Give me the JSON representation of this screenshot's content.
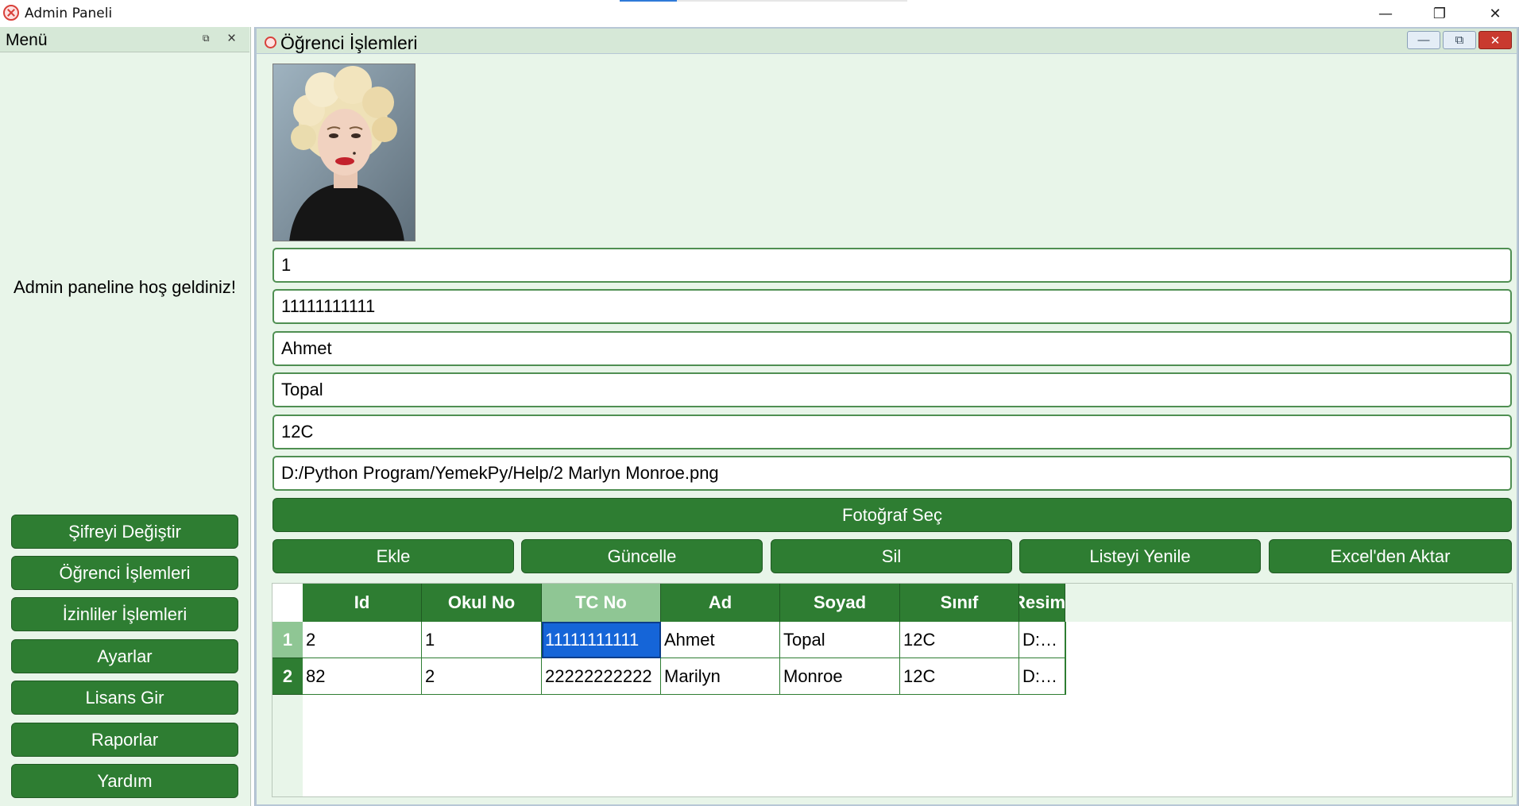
{
  "window": {
    "title": "Admin Paneli",
    "minimize_glyph": "—",
    "maximize_glyph": "❐",
    "close_glyph": "✕"
  },
  "dock": {
    "title": "Menü",
    "float_glyph": "⧉",
    "close_glyph": "×",
    "welcome": "Admin paneline hoş geldiniz!",
    "buttons": [
      "Şifreyi Değiştir",
      "Öğrenci İşlemleri",
      "İzinliler İşlemleri",
      "Ayarlar",
      "Lisans Gir",
      "Raporlar",
      "Yardım"
    ]
  },
  "subwindow": {
    "title": "Öğrenci İşlemleri",
    "minimize_glyph": "—",
    "restore_glyph": "⧉",
    "close_glyph": "✕",
    "fields": {
      "id": "1",
      "tc_no": "11111111111",
      "ad": "Ahmet",
      "soyad": "Topal",
      "sinif": "12C",
      "resim_path": "D:/Python Program/YemekPy/Help/2 Marlyn Monroe.png"
    },
    "photo_button": "Fotoğraf Seç",
    "actions": [
      "Ekle",
      "Güncelle",
      "Sil",
      "Listeyi Yenile",
      "Excel'den Aktar"
    ],
    "table": {
      "columns": [
        "Id",
        "Okul No",
        "TC No",
        "Ad",
        "Soyad",
        "Sınıf",
        "Resim"
      ],
      "row_headers": [
        "1",
        "2"
      ],
      "rows": [
        [
          "2",
          "1",
          "11111111111",
          "Ahmet",
          "Topal",
          "12C",
          "D:…"
        ],
        [
          "82",
          "2",
          "22222222222",
          "Marilyn",
          "Monroe",
          "12C",
          "D:…"
        ]
      ],
      "selected": {
        "row": 0,
        "column": 2
      }
    }
  },
  "colors": {
    "accent_green": "#2e7d32",
    "panel_bg": "#e8f5e9",
    "selection_blue": "#1565d8"
  }
}
